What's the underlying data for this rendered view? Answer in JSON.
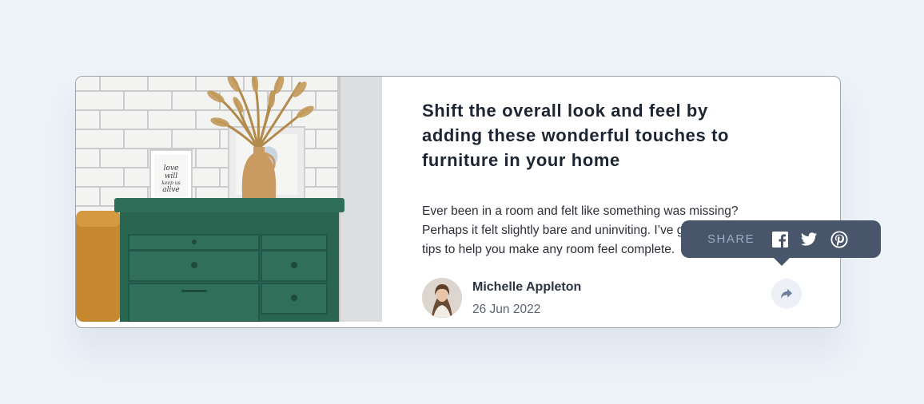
{
  "article": {
    "title": "Shift the overall look and feel by adding these wonderful touches to furniture in your home",
    "excerpt": "Ever been in a room and felt like something was missing? Perhaps it felt slightly bare and uninviting. I’ve got some simple tips to help you make any room feel complete.",
    "image_alt": "Green dresser with vase of dried grass against white brick wall",
    "frame_text": "love will keep us alive"
  },
  "author": {
    "name": "Michelle Appleton",
    "date": "26 Jun 2022"
  },
  "share": {
    "label": "SHARE",
    "networks": [
      {
        "name": "Facebook",
        "icon": "facebook-icon"
      },
      {
        "name": "Twitter",
        "icon": "twitter-icon"
      },
      {
        "name": "Pinterest",
        "icon": "pinterest-icon"
      }
    ],
    "button_icon": "share-arrow-icon"
  },
  "colors": {
    "background": "#ecf2f8",
    "card": "#ffffff",
    "tooltip": "#48556b",
    "tooltip_label": "#9eaac0",
    "title": "#1e2532",
    "dresser": "#2e6d58"
  }
}
